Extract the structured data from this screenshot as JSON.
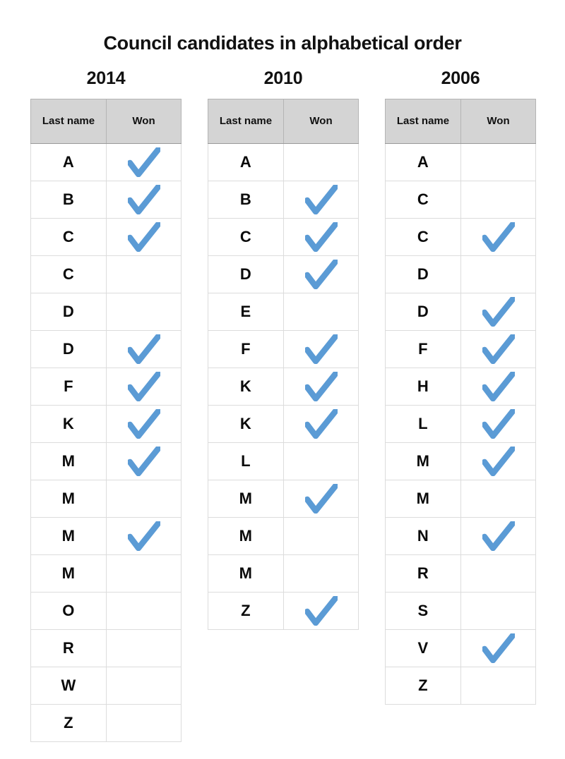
{
  "page": {
    "title": "Council candidates in alphabetical order",
    "check_color": "#5b9bd5",
    "header_bg": "#d4d4d4",
    "check_icon_name": "check-mark-icon"
  },
  "columns": {
    "last_name": "Last name",
    "won": "Won"
  },
  "tables": [
    {
      "year": "2014",
      "rows": [
        {
          "name": "A",
          "won": true
        },
        {
          "name": "B",
          "won": true
        },
        {
          "name": "C",
          "won": true
        },
        {
          "name": "C",
          "won": false
        },
        {
          "name": "D",
          "won": false
        },
        {
          "name": "D",
          "won": true
        },
        {
          "name": "F",
          "won": true
        },
        {
          "name": "K",
          "won": true
        },
        {
          "name": "M",
          "won": true
        },
        {
          "name": "M",
          "won": false
        },
        {
          "name": "M",
          "won": true
        },
        {
          "name": "M",
          "won": false
        },
        {
          "name": "O",
          "won": false
        },
        {
          "name": "R",
          "won": false
        },
        {
          "name": "W",
          "won": false
        },
        {
          "name": "Z",
          "won": false
        }
      ]
    },
    {
      "year": "2010",
      "rows": [
        {
          "name": "A",
          "won": false
        },
        {
          "name": "B",
          "won": true
        },
        {
          "name": "C",
          "won": true
        },
        {
          "name": "D",
          "won": true
        },
        {
          "name": "E",
          "won": false
        },
        {
          "name": "F",
          "won": true
        },
        {
          "name": "K",
          "won": true
        },
        {
          "name": "K",
          "won": true
        },
        {
          "name": "L",
          "won": false
        },
        {
          "name": "M",
          "won": true
        },
        {
          "name": "M",
          "won": false
        },
        {
          "name": "M",
          "won": false
        },
        {
          "name": "Z",
          "won": true
        }
      ]
    },
    {
      "year": "2006",
      "rows": [
        {
          "name": "A",
          "won": false
        },
        {
          "name": "C",
          "won": false
        },
        {
          "name": "C",
          "won": true
        },
        {
          "name": "D",
          "won": false
        },
        {
          "name": "D",
          "won": true
        },
        {
          "name": "F",
          "won": true
        },
        {
          "name": "H",
          "won": true
        },
        {
          "name": "L",
          "won": true
        },
        {
          "name": "M",
          "won": true
        },
        {
          "name": "M",
          "won": false
        },
        {
          "name": "N",
          "won": true
        },
        {
          "name": "R",
          "won": false
        },
        {
          "name": "S",
          "won": false
        },
        {
          "name": "V",
          "won": true
        },
        {
          "name": "Z",
          "won": false
        }
      ]
    }
  ]
}
